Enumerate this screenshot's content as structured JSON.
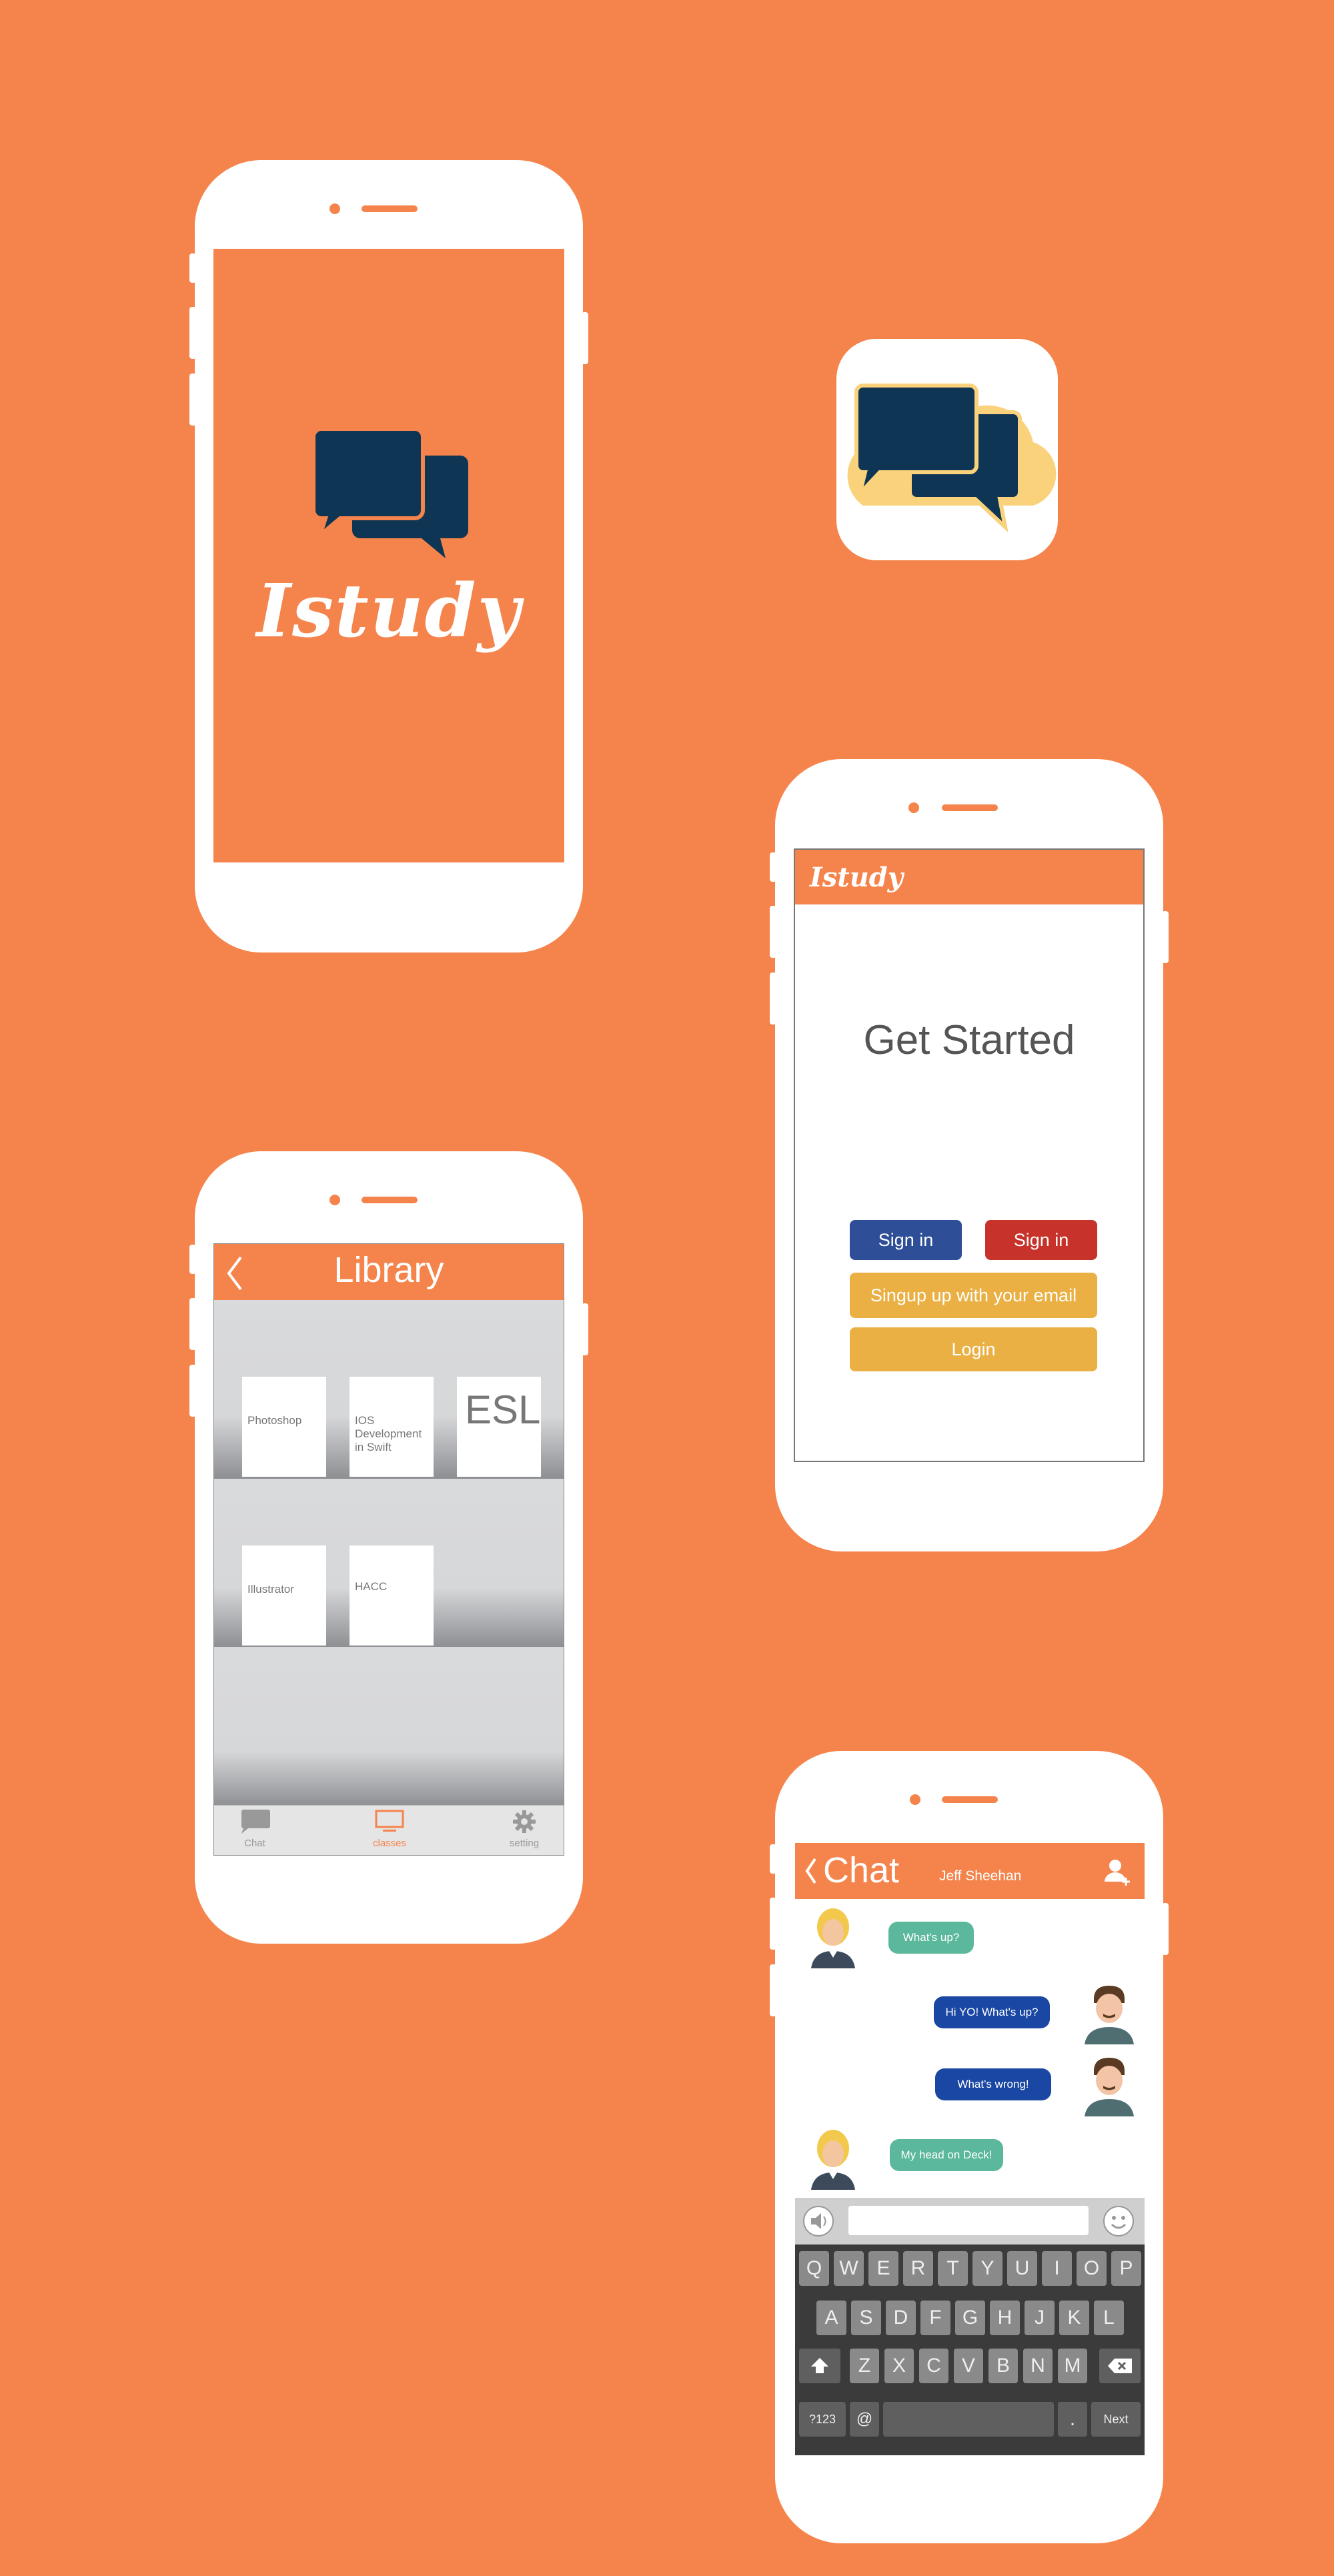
{
  "colors": {
    "background": "#F5844C",
    "navy": "#0E3554",
    "cloud": "#F9D27B",
    "sign_in_blue": "#2E4F98",
    "sign_in_red": "#C7332B",
    "gold": "#EAB043",
    "teal_bubble": "#5BB89C",
    "blue_bubble": "#1A47A3"
  },
  "splash": {
    "logo_icon": "chat-bubbles-icon",
    "brand": "Istudy"
  },
  "app_icon": {
    "icon": "chat-bubbles-cloud-icon"
  },
  "get_started": {
    "brand": "Istudy",
    "title": "Get Started",
    "sign_in_1": "Sign in",
    "sign_in_2": "Sign in",
    "signup_email": "Singup up with your email",
    "login": "Login"
  },
  "library": {
    "back_icon": "chevron-left-icon",
    "title": "Library",
    "books": [
      {
        "title": "Photoshop"
      },
      {
        "title": "IOS Development in Swift"
      },
      {
        "title": "ESL"
      },
      {
        "title": "Illustrator"
      },
      {
        "title": "HACC"
      }
    ],
    "tabs": [
      {
        "label": "Chat",
        "icon": "chat-icon"
      },
      {
        "label": "classes",
        "icon": "monitor-icon"
      },
      {
        "label": "setting",
        "icon": "gear-icon"
      }
    ]
  },
  "chat": {
    "back_icon": "chevron-left-icon",
    "title": "Chat",
    "contact": "Jeff Sheehan",
    "add_user_icon": "add-user-icon",
    "messages": [
      {
        "text": "What's up?",
        "side": "left"
      },
      {
        "text": "Hi YO! What's up?",
        "side": "right"
      },
      {
        "text": "What's wrong!",
        "side": "right"
      },
      {
        "text": "My head on Deck!",
        "side": "left"
      }
    ],
    "input_placeholder": "",
    "keyboard": {
      "row1": [
        "Q",
        "W",
        "E",
        "R",
        "T",
        "Y",
        "U",
        "I",
        "O",
        "P"
      ],
      "row2": [
        "A",
        "S",
        "D",
        "F",
        "G",
        "H",
        "J",
        "K",
        "L"
      ],
      "row3": [
        "Z",
        "X",
        "C",
        "V",
        "B",
        "N",
        "M"
      ],
      "sym": "?123",
      "at": "@",
      "dot": ".",
      "next": "Next"
    }
  }
}
